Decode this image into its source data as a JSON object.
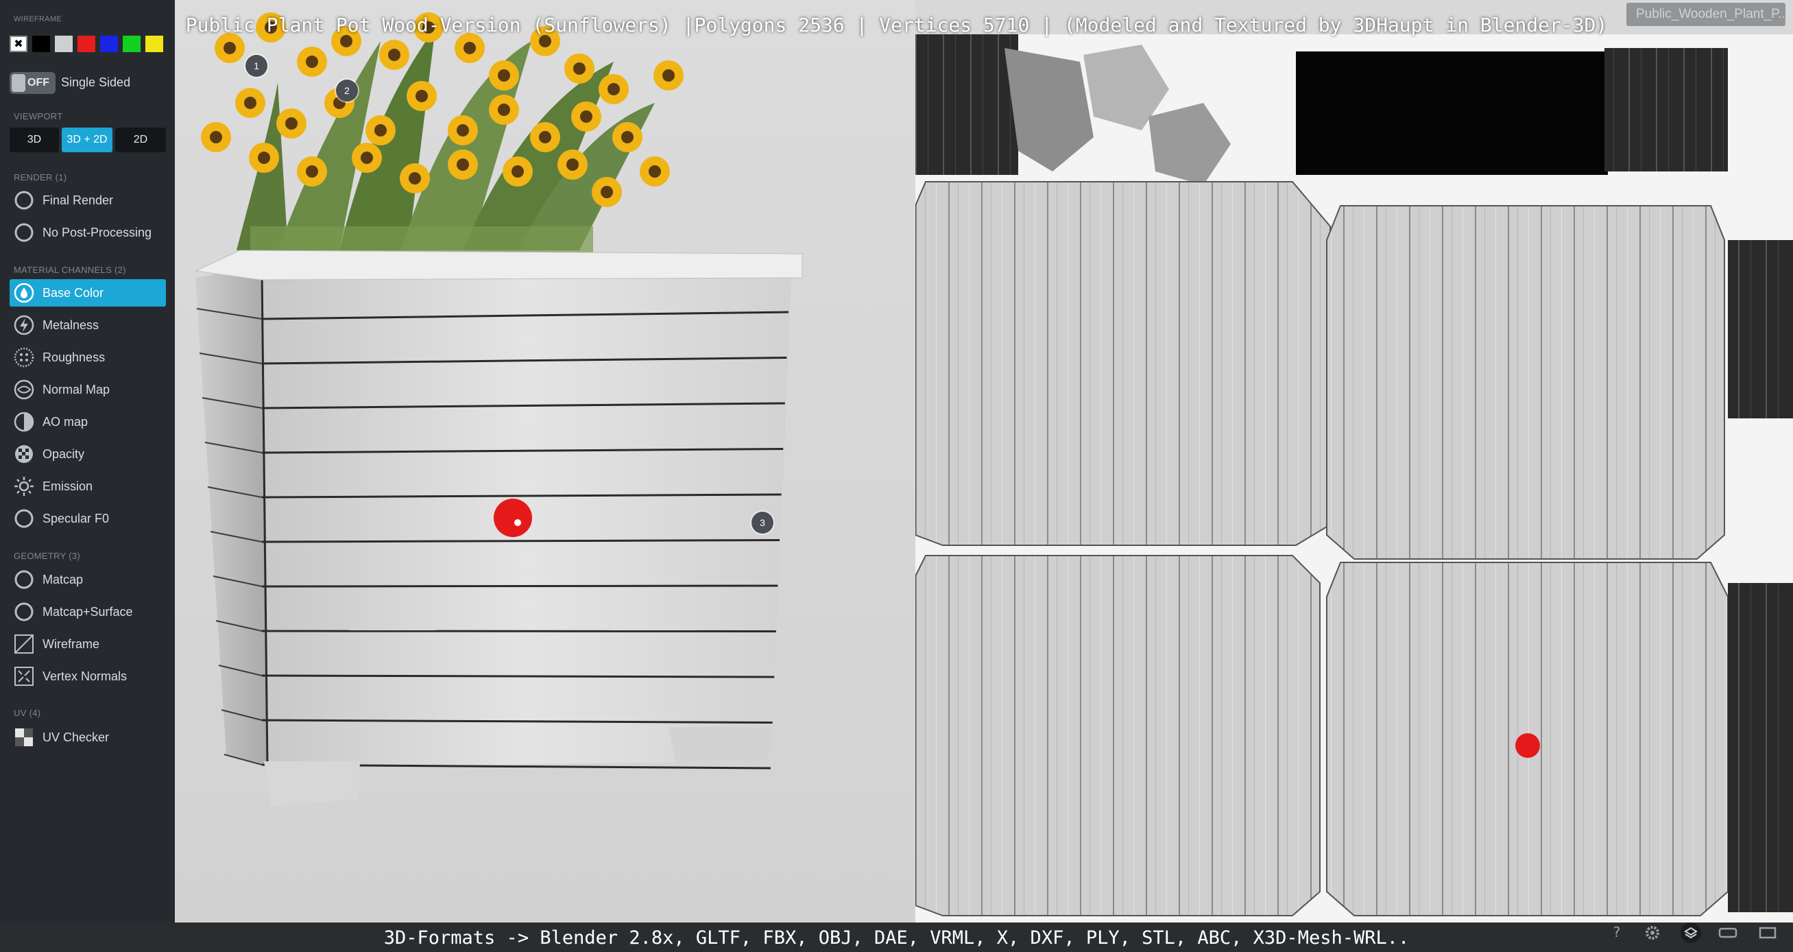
{
  "title": "Public Plant Pot Wood-Version (Sunflowers) |Polygons 2536 | Vertices 5710 | (Modeled and Textured by 3DHaupt in Blender-3D)",
  "asset_tag": "Public_Wooden_Plant_P...",
  "formats": "3D-Formats -> Blender 2.8x, GLTF, FBX, OBJ, DAE, VRML, X, DXF, PLY, STL, ABC, X3D-Mesh-WRL..",
  "colors": {
    "accent": "#1ca7d6",
    "sidebar_bg": "#262a2e",
    "marker": "#e41a1a"
  },
  "sidebar": {
    "wireframe_label": "WIREFRAME",
    "wireframe_colors": [
      "#ffffff",
      "#000000",
      "#cfcfcf",
      "#e51d1d",
      "#1a24e6",
      "#13d11f",
      "#f2e416"
    ],
    "toggle_state": "OFF",
    "single_sided_label": "Single Sided",
    "viewport_label": "VIEWPORT",
    "viewport_buttons": [
      "3D",
      "3D + 2D",
      "2D"
    ],
    "render_label": "RENDER (1)",
    "render_items": [
      {
        "label": "Final Render",
        "icon": "radio-icon"
      },
      {
        "label": "No Post-Processing",
        "icon": "radio-icon"
      }
    ],
    "material_label": "MATERIAL CHANNELS (2)",
    "material_items": [
      {
        "label": "Base Color",
        "icon": "droplet-icon",
        "active": true
      },
      {
        "label": "Metalness",
        "icon": "lightning-icon"
      },
      {
        "label": "Roughness",
        "icon": "dots-icon"
      },
      {
        "label": "Normal Map",
        "icon": "normal-map-icon"
      },
      {
        "label": "AO map",
        "icon": "half-circle-icon"
      },
      {
        "label": "Opacity",
        "icon": "checker-circle-icon"
      },
      {
        "label": "Emission",
        "icon": "sun-icon"
      },
      {
        "label": "Specular F0",
        "icon": "radio-icon"
      }
    ],
    "geometry_label": "GEOMETRY (3)",
    "geometry_items": [
      {
        "label": "Matcap",
        "icon": "radio-icon"
      },
      {
        "label": "Matcap+Surface",
        "icon": "radio-icon"
      },
      {
        "label": "Wireframe",
        "icon": "wireframe-icon"
      },
      {
        "label": "Vertex Normals",
        "icon": "vertex-normals-icon"
      }
    ],
    "uv_label": "UV (4)",
    "uv_items": [
      {
        "label": "UV Checker",
        "icon": "checker-icon"
      }
    ]
  },
  "hotspots": [
    "1",
    "2",
    "3"
  ]
}
